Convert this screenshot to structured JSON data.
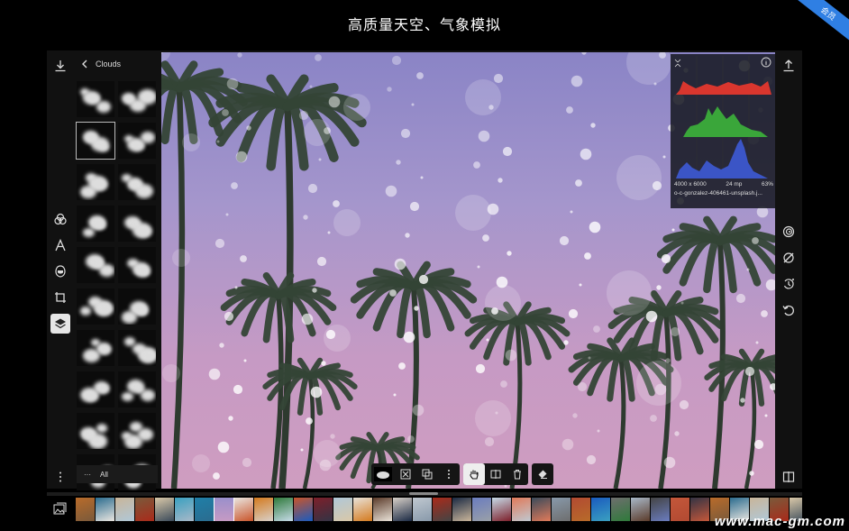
{
  "banner": {
    "heading": "高质量天空、气象模拟",
    "ribbon": "会员"
  },
  "panel": {
    "title": "Clouds",
    "footer_label": "All"
  },
  "histogram": {
    "resolution": "4000 x 6000",
    "megapixels": "24 mp",
    "zoom": "63%",
    "filename": "o-c-gonzalez-406461-unsplash.j..."
  },
  "watermark": "www.mac-gm.com",
  "colors": {
    "accent": "#2f7fe3",
    "panel_bg": "#111111",
    "sky_top": "#8a84c6",
    "sky_bottom": "#cf9dc0",
    "hist_red": "#d9362e",
    "hist_green": "#3aa63a",
    "hist_blue": "#3b55c6"
  },
  "icons": {
    "left_rail": [
      "download-icon",
      "overlap-circles-icon",
      "text-icon",
      "mask-icon",
      "crop-icon",
      "layers-icon",
      "more-icon"
    ],
    "right_rail": [
      "share-icon",
      "spiral-icon",
      "erase-line-icon",
      "history-icon",
      "undo-icon",
      "compare-icon"
    ],
    "toolbar": [
      "layer-thumb",
      "fit-icon",
      "duplicate-icon",
      "more-vertical-icon",
      "hand-icon",
      "flip-icon",
      "trash-icon",
      "eraser-icon"
    ]
  }
}
